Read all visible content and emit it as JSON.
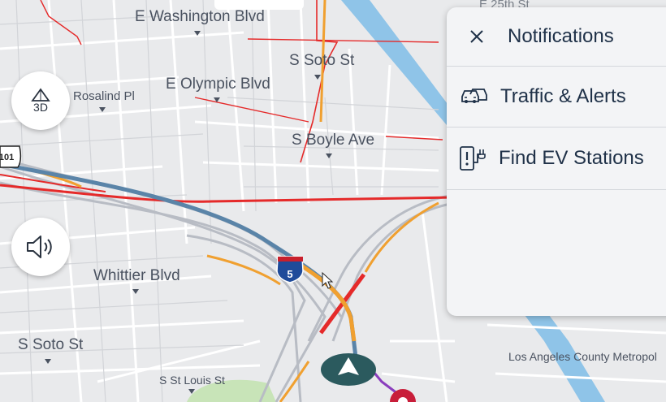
{
  "map": {
    "labels": {
      "e_washington": "E Washington Blvd",
      "s_soto_top": "S Soto St",
      "e_olympic": "E Olympic Blvd",
      "rosalind": "Rosalind Pl",
      "s_boyle": "S Boyle Ave",
      "whittier": "Whittier Blvd",
      "s_soto_bottom": "S Soto St",
      "s_st_louis": "S St Louis St",
      "la_county": "Los Angeles County Metropol",
      "e_25th": "E 25th St"
    },
    "shields": {
      "interstate": "5",
      "us_route": "101"
    }
  },
  "controls": {
    "view_3d_label": "3D",
    "view_3d_icon": "triangle-3d-icon",
    "volume_icon": "speaker-volume-icon"
  },
  "panel": {
    "close_icon": "close-icon",
    "title": "Notifications",
    "items": [
      {
        "label": "Traffic & Alerts",
        "icon": "traffic-cars-icon"
      },
      {
        "label": "Find EV Stations",
        "icon": "ev-charger-icon"
      }
    ]
  },
  "colors": {
    "map_background": "#e9eaec",
    "route": "#5a84a8",
    "traffic_red": "#e52a2a",
    "road_orange": "#f0a030",
    "water": "#8fc4e8",
    "park": "#c8e4b8",
    "panel_bg": "#f3f4f6",
    "panel_text": "#1f3148",
    "nav_arrow": "#2b5a5e"
  }
}
